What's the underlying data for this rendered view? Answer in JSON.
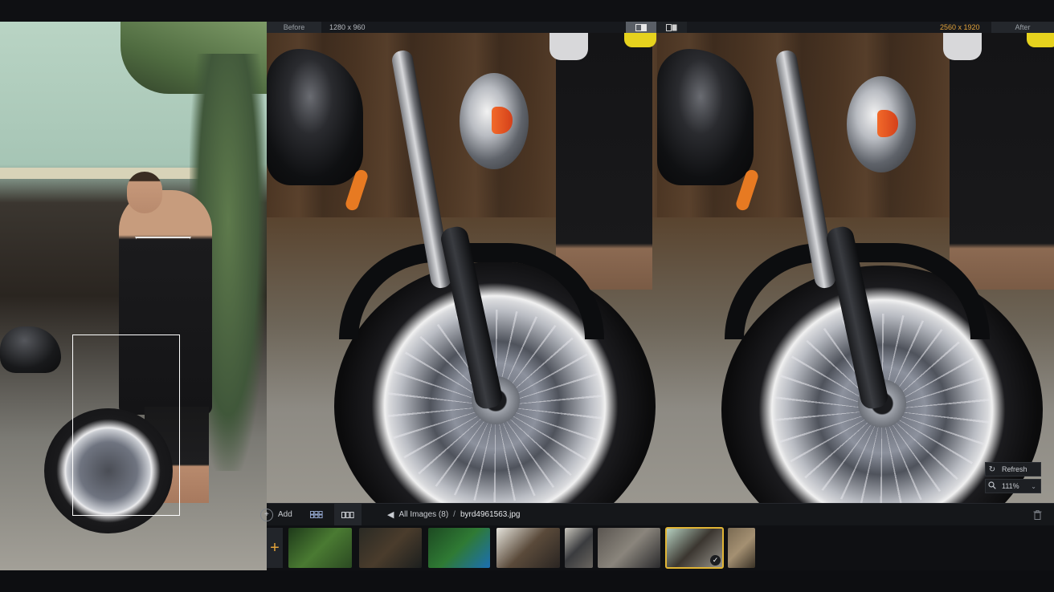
{
  "compare": {
    "before_label": "Before",
    "before_resolution": "1280 x 960",
    "after_resolution": "2560 x 1920",
    "after_label": "After"
  },
  "view_toggle": {
    "options": [
      "split-view-icon",
      "side-by-side-icon"
    ],
    "active": "split-view-icon"
  },
  "controls": {
    "refresh_label": "Refresh",
    "zoom_value": "111%"
  },
  "toolbar": {
    "add_label": "Add",
    "breadcrumb_root": "All Images (8)",
    "breadcrumb_sep": "/",
    "file_name": "byrd4961563.jpg"
  },
  "filmstrip": {
    "add_icon": "+",
    "thumbnails": [
      {
        "name": "thumb-plant",
        "colors": [
          "#1e3a1a",
          "#4a7a32",
          "#2b4a22"
        ]
      },
      {
        "name": "thumb-lake",
        "colors": [
          "#2a2a24",
          "#4a3c2c",
          "#1c1f1e"
        ]
      },
      {
        "name": "thumb-parrot",
        "colors": [
          "#1d4a22",
          "#2f7a34",
          "#1b6fb3"
        ]
      },
      {
        "name": "thumb-workshop",
        "colors": [
          "#e6e4dc",
          "#5a4a3a",
          "#2a2522"
        ]
      },
      {
        "name": "thumb-person",
        "colors": [
          "#c9c6bd",
          "#3a3b3e",
          "#6a6660"
        ]
      },
      {
        "name": "thumb-garage",
        "colors": [
          "#5a5550",
          "#8a857c",
          "#2a2a2c"
        ]
      },
      {
        "name": "thumb-motorcycle",
        "colors": [
          "#b9d4c4",
          "#3b3630",
          "#9a978f"
        ],
        "selected": true
      },
      {
        "name": "thumb-interior",
        "colors": [
          "#7a6a52",
          "#a49072",
          "#3a3226"
        ]
      }
    ]
  },
  "colors": {
    "accent": "#e3a33a",
    "selection_border": "#e1b535",
    "panel": "#15171a"
  }
}
